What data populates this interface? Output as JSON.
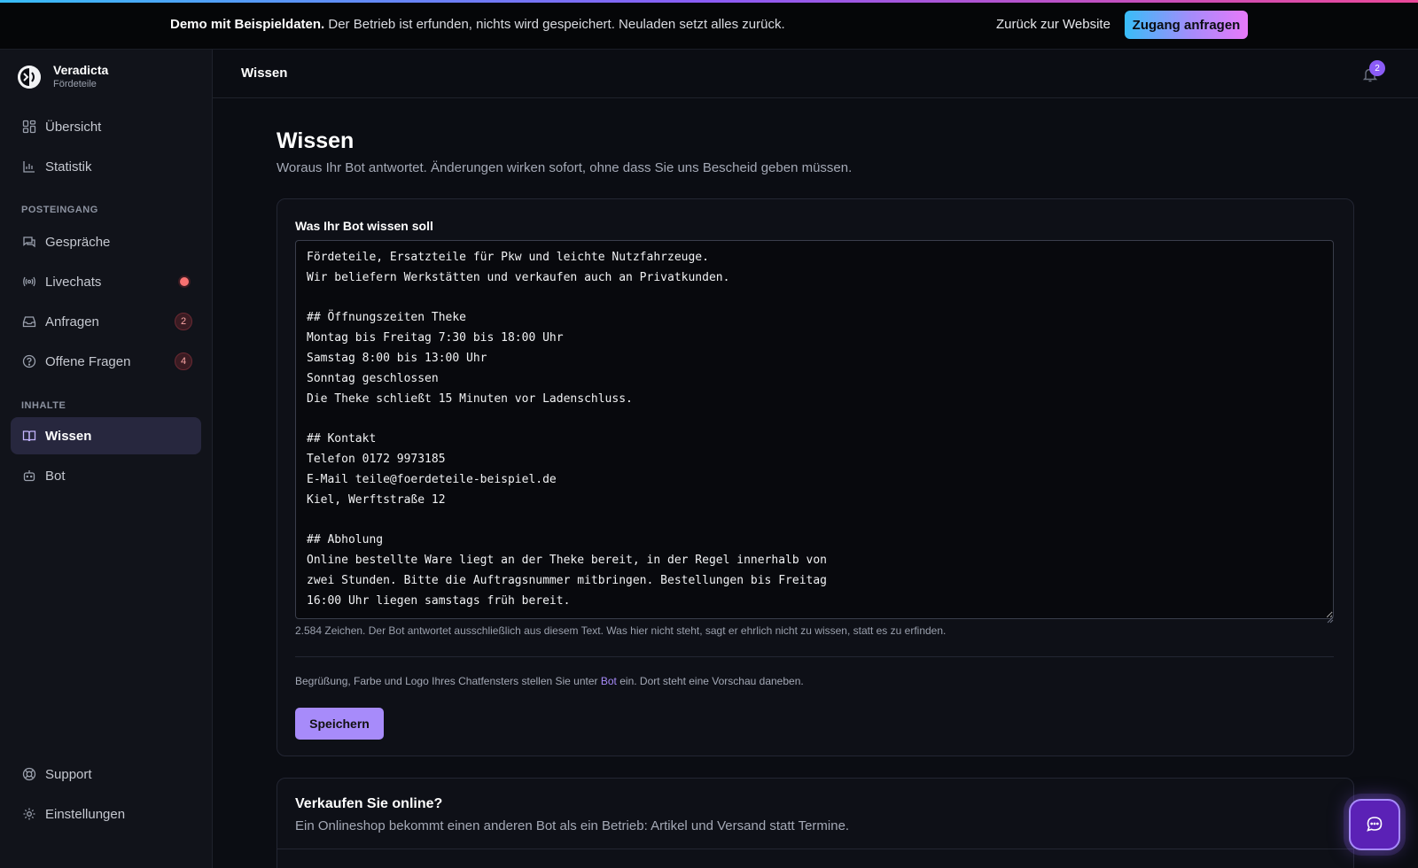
{
  "banner": {
    "bold": "Demo mit Beispieldaten.",
    "text": " Der Betrieb ist erfunden, nichts wird gespeichert. Neuladen setzt alles zurück.",
    "back_link": "Zurück zur Website",
    "access_button": "Zugang anfragen"
  },
  "brand": {
    "name": "Veradicta",
    "sub": "Fördeteile"
  },
  "sidebar": {
    "items_top": [
      {
        "label": "Übersicht",
        "icon": "grid-icon"
      },
      {
        "label": "Statistik",
        "icon": "bar-chart-icon"
      }
    ],
    "section_inbox": "POSTEINGANG",
    "items_inbox": [
      {
        "label": "Gespräche",
        "icon": "chat-icon"
      },
      {
        "label": "Livechats",
        "icon": "broadcast-icon"
      },
      {
        "label": "Anfragen",
        "icon": "inbox-icon",
        "badge": "2"
      },
      {
        "label": "Offene Fragen",
        "icon": "help-circle-icon",
        "badge": "4"
      }
    ],
    "section_content": "INHALTE",
    "items_content": [
      {
        "label": "Wissen",
        "icon": "book-icon",
        "active": true
      },
      {
        "label": "Bot",
        "icon": "bot-icon"
      }
    ],
    "items_bottom": [
      {
        "label": "Support",
        "icon": "lifebuoy-icon"
      },
      {
        "label": "Einstellungen",
        "icon": "gear-icon"
      }
    ]
  },
  "header": {
    "title": "Wissen",
    "notifications": "2"
  },
  "main": {
    "title": "Wissen",
    "subtitle": "Woraus Ihr Bot antwortet. Änderungen wirken sofort, ohne dass Sie uns Bescheid geben müssen.",
    "card_label": "Was Ihr Bot wissen soll",
    "knowledge_text": "Fördeteile, Ersatzteile für Pkw und leichte Nutzfahrzeuge.\nWir beliefern Werkstätten und verkaufen auch an Privatkunden.\n\n## Öffnungszeiten Theke\nMontag bis Freitag 7:30 bis 18:00 Uhr\nSamstag 8:00 bis 13:00 Uhr\nSonntag geschlossen\nDie Theke schließt 15 Minuten vor Ladenschluss.\n\n## Kontakt\nTelefon 0172 9973185\nE-Mail teile@foerdeteile-beispiel.de\nKiel, Werftstraße 12\n\n## Abholung\nOnline bestellte Ware liegt an der Theke bereit, in der Regel innerhalb von\nzwei Stunden. Bitte die Auftragsnummer mitbringen. Bestellungen bis Freitag\n16:00 Uhr liegen samstags früh bereit.",
    "char_info": "2.584 Zeichen. Der Bot antwortet ausschließlich aus diesem Text. Was hier nicht steht, sagt er ehrlich nicht zu wissen, statt es zu erfinden.",
    "hint_before": "Begrüßung, Farbe und Logo Ihres Chatfensters stellen Sie unter ",
    "hint_link": "Bot",
    "hint_after": " ein. Dort steht eine Vorschau daneben.",
    "save_button": "Speichern"
  },
  "shop_card": {
    "title": "Verkaufen Sie online?",
    "subtitle": "Ein Onlineshop bekommt einen anderen Bot als ein Betrieb: Artikel und Versand statt Termine."
  },
  "colors": {
    "accent": "#a78bfa",
    "badge_red": "#f87171"
  }
}
